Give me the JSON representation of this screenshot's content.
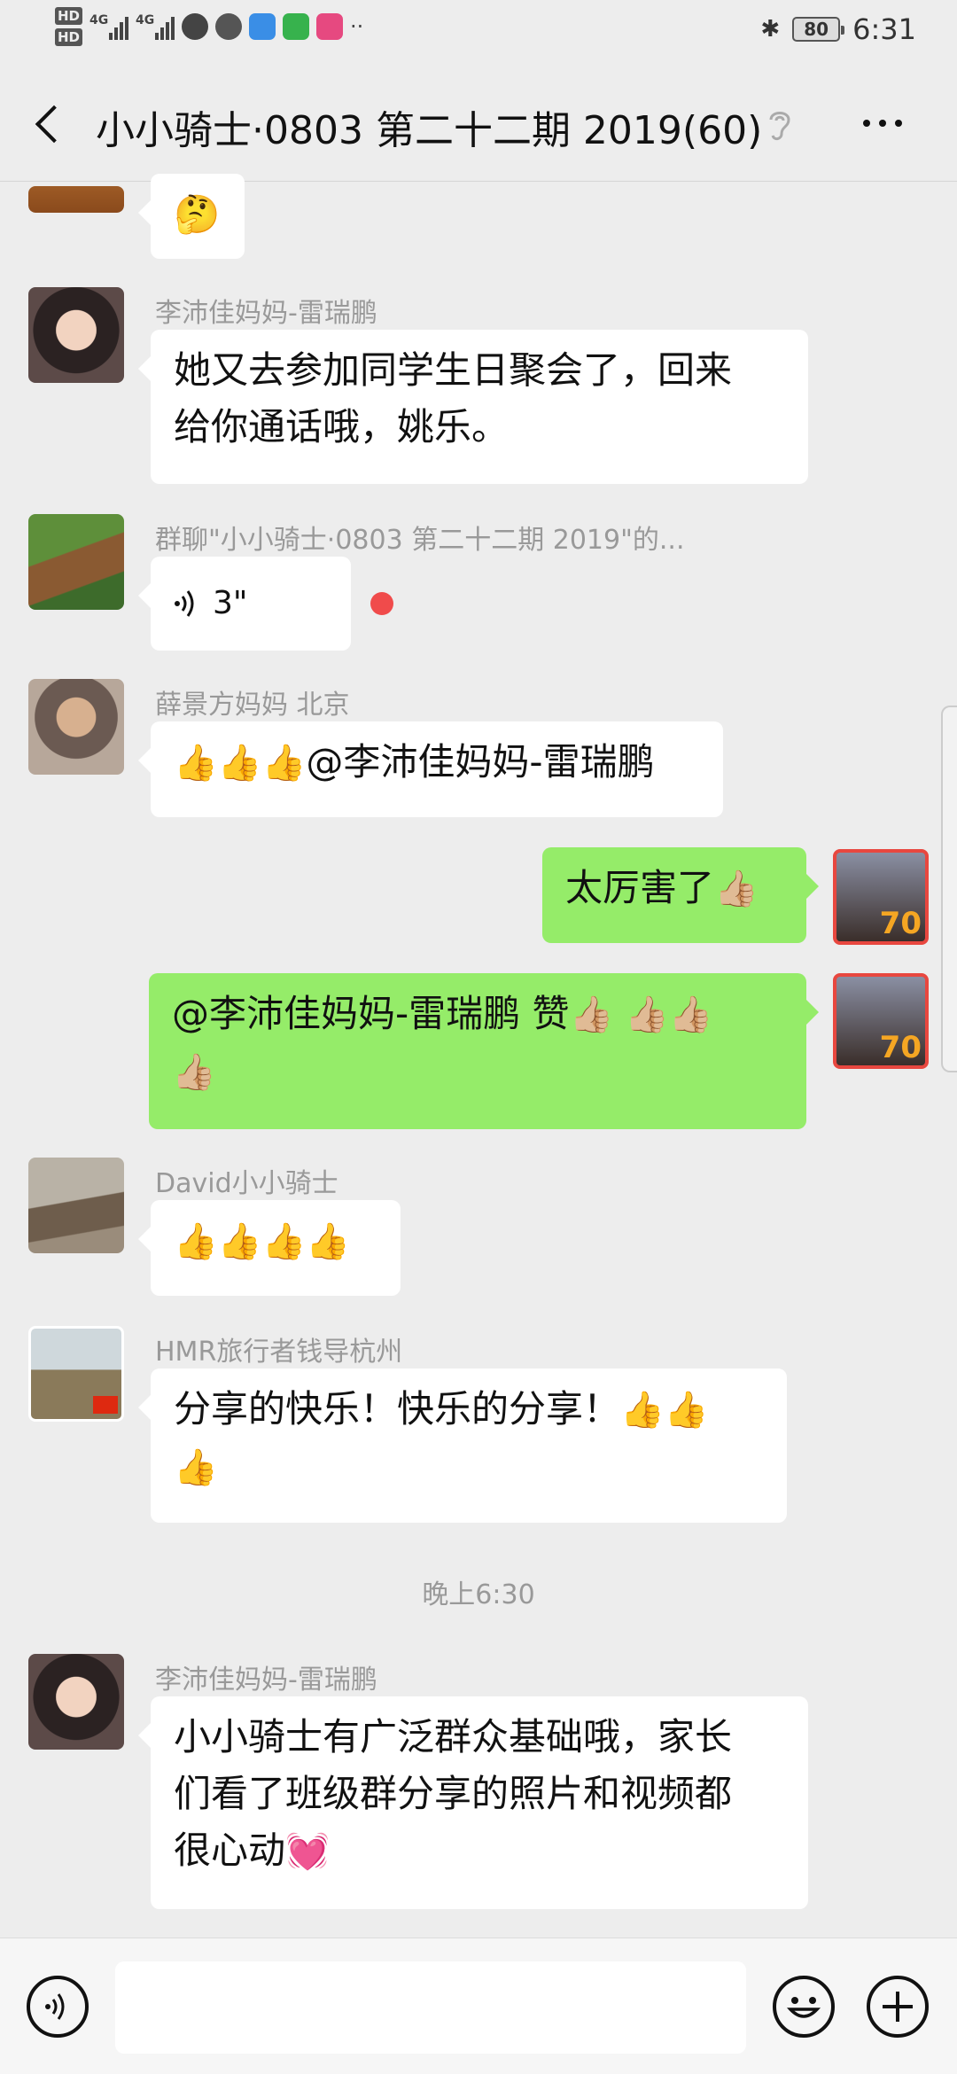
{
  "status_bar": {
    "time": "6:31",
    "battery": "80",
    "hd1": "HD",
    "hd2": "HD",
    "sig1": "4G",
    "sig2": "4G"
  },
  "header": {
    "title": "小小骑士·0803 第二十二期 2019(60)"
  },
  "messages": {
    "m0": {
      "text": "🤔"
    },
    "m1": {
      "sender": "李沛佳妈妈-雷瑞鹏",
      "line1": "她又去参加同学生日聚会了，回来",
      "line2": "给你通话哦，姚乐。"
    },
    "m2": {
      "sender": "群聊\"小小骑士·0803 第二十二期 2019\"的...",
      "duration": "3\""
    },
    "m3": {
      "sender": "薛景方妈妈 北京",
      "thumbs": "👍👍👍",
      "text": "@李沛佳妈妈-雷瑞鹏"
    },
    "m4": {
      "text": "太厉害了",
      "thumb": "👍🏼"
    },
    "m5": {
      "text": "@李沛佳妈妈-雷瑞鹏  赞",
      "thumbs": "👍🏼 👍🏼👍🏼",
      "thumb2": "👍🏼"
    },
    "m6": {
      "sender": "David小小骑士",
      "thumbs": "👍👍👍👍"
    },
    "m7": {
      "sender": "HMR旅行者钱导杭州",
      "text": "分享的快乐！快乐的分享！",
      "thumbs": "👍👍",
      "thumb2": "👍"
    },
    "time_label": "晚上6:30",
    "m8": {
      "sender": "李沛佳妈妈-雷瑞鹏",
      "line1": "小小骑士有广泛群众基础哦，家长",
      "line2": "们看了班级群分享的照片和视频都",
      "line3": "很心动",
      "heart": "💓"
    }
  },
  "self_badge": "70",
  "input_bar": {
    "placeholder": ""
  },
  "colors": {
    "green_bubble": "#95ec69",
    "background": "#ededed",
    "unread_dot": "#f04b4b"
  }
}
